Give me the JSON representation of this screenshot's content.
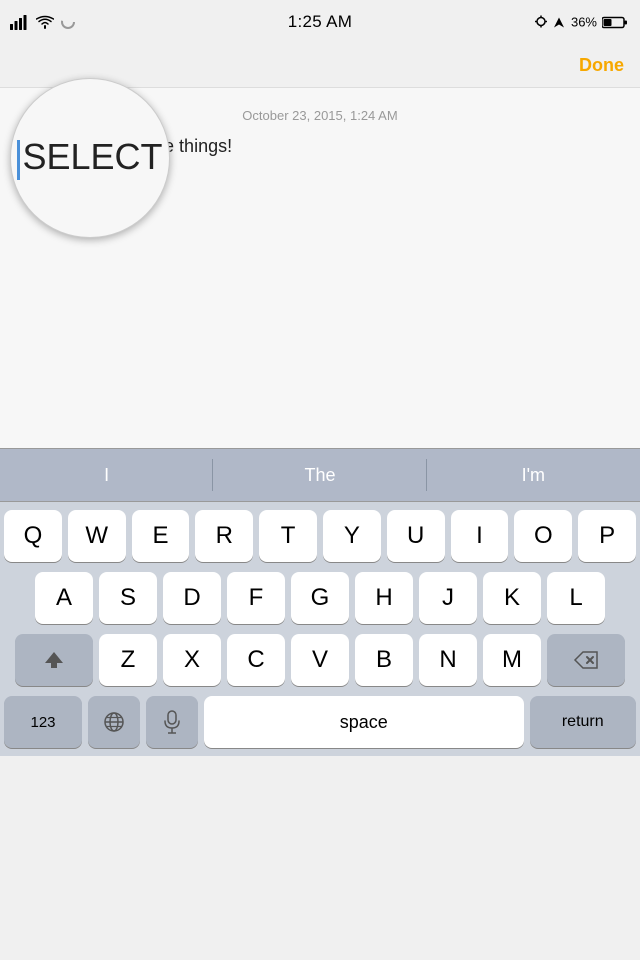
{
  "statusBar": {
    "time": "1:25 AM",
    "battery": "36%",
    "signal": "●●●",
    "wifi": "wifi",
    "location": true
  },
  "navBar": {
    "doneLabel": "Done"
  },
  "note": {
    "date": "October 23, 2015, 1:24 AM",
    "text": "SELECTING all the things!"
  },
  "loupe": {
    "text": "SELECT"
  },
  "autocomplete": {
    "items": [
      "I",
      "The",
      "I'm"
    ]
  },
  "keyboard": {
    "row1": [
      "Q",
      "W",
      "E",
      "R",
      "T",
      "Y",
      "U",
      "I",
      "O",
      "P"
    ],
    "row2": [
      "A",
      "S",
      "D",
      "F",
      "G",
      "H",
      "J",
      "K",
      "L"
    ],
    "row3": [
      "Z",
      "X",
      "C",
      "V",
      "B",
      "N",
      "M"
    ],
    "shiftIcon": "⬆",
    "deleteIcon": "⌫",
    "numbersLabel": "123",
    "globeIcon": "🌐",
    "micIcon": "🎤",
    "spaceLabel": "space",
    "returnLabel": "return"
  }
}
